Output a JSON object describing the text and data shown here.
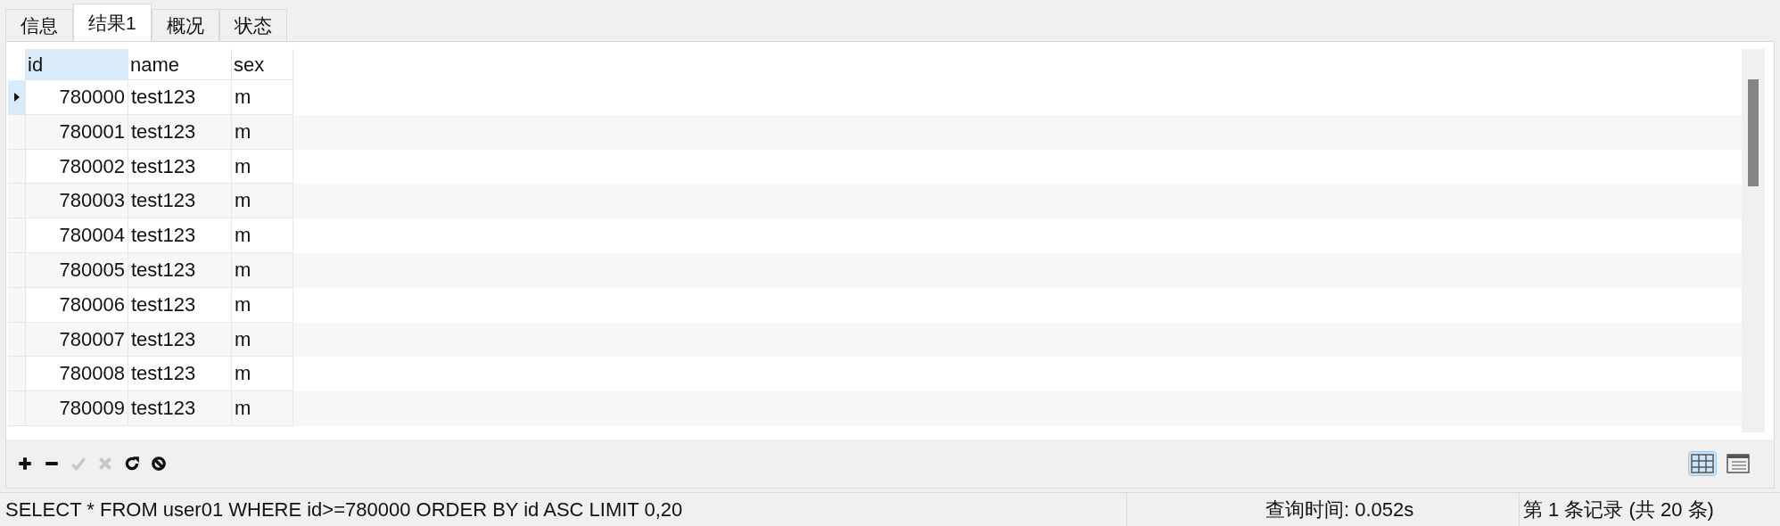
{
  "tabs": [
    {
      "label": "信息",
      "selected": false
    },
    {
      "label": "结果1",
      "selected": true
    },
    {
      "label": "概况",
      "selected": false
    },
    {
      "label": "状态",
      "selected": false
    }
  ],
  "table": {
    "columns": [
      "id",
      "name",
      "sex"
    ],
    "rows": [
      {
        "cells": [
          "780000",
          "test123",
          "m"
        ],
        "selected": true
      },
      {
        "cells": [
          "780001",
          "test123",
          "m"
        ],
        "selected": false
      },
      {
        "cells": [
          "780002",
          "test123",
          "m"
        ],
        "selected": false
      },
      {
        "cells": [
          "780003",
          "test123",
          "m"
        ],
        "selected": false
      },
      {
        "cells": [
          "780004",
          "test123",
          "m"
        ],
        "selected": false
      },
      {
        "cells": [
          "780005",
          "test123",
          "m"
        ],
        "selected": false
      },
      {
        "cells": [
          "780006",
          "test123",
          "m"
        ],
        "selected": false
      },
      {
        "cells": [
          "780007",
          "test123",
          "m"
        ],
        "selected": false
      },
      {
        "cells": [
          "780008",
          "test123",
          "m"
        ],
        "selected": false
      },
      {
        "cells": [
          "780009",
          "test123",
          "m"
        ],
        "selected": false
      }
    ]
  },
  "toolbar": [
    {
      "kind": "add",
      "disabled": false
    },
    {
      "kind": "remove",
      "disabled": false
    },
    {
      "kind": "apply",
      "disabled": true
    },
    {
      "kind": "discard",
      "disabled": true
    },
    {
      "kind": "refresh",
      "disabled": false
    },
    {
      "kind": "stop",
      "disabled": false
    }
  ],
  "view_toggle": [
    {
      "kind": "grid",
      "selected": true
    },
    {
      "kind": "form",
      "selected": false
    }
  ],
  "status_bar": {
    "query": "SELECT * FROM user01  WHERE id>=780000  ORDER BY id ASC  LIMIT 0,20",
    "query_time": "查询时间: 0.052s",
    "record": "第 1 条记录 (共 20 条)"
  }
}
